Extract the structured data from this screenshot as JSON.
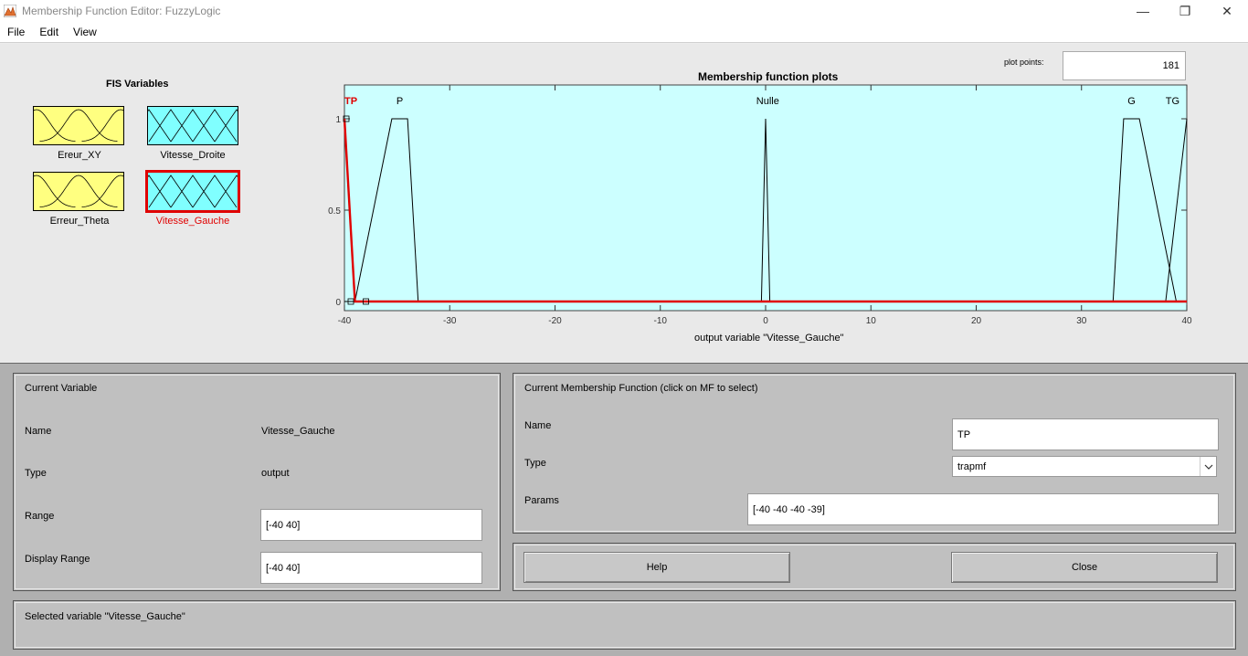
{
  "window": {
    "title": "Membership Function Editor: FuzzyLogic",
    "minimize_glyph": "—",
    "restore_glyph": "❐",
    "close_glyph": "✕"
  },
  "menu": [
    "File",
    "Edit",
    "View"
  ],
  "fis": {
    "title": "FIS Variables",
    "variables": [
      {
        "name": "Ereur_XY",
        "kind": "input",
        "color": "#ffff80"
      },
      {
        "name": "Vitesse_Droite",
        "kind": "output",
        "color": "#80ffff"
      },
      {
        "name": "Erreur_Theta",
        "kind": "input",
        "color": "#ffff80"
      },
      {
        "name": "Vitesse_Gauche",
        "kind": "output",
        "color": "#80ffff",
        "selected": true
      }
    ]
  },
  "plot_points": {
    "label": "plot points:",
    "value": "181"
  },
  "chart_data": {
    "type": "line",
    "title": "Membership function plots",
    "xlabel": "output variable \"Vitesse_Gauche\"",
    "xlim": [
      -40,
      40
    ],
    "ylim": [
      0,
      1
    ],
    "xticks": [
      -40,
      -30,
      -20,
      -10,
      0,
      10,
      20,
      30,
      40
    ],
    "yticks": [
      0,
      0.5,
      1
    ],
    "background": "#ccffff",
    "selected_color": "#e00000",
    "series": [
      {
        "name": "TP",
        "type": "trapmf",
        "params": [
          -40,
          -40,
          -40,
          -39
        ],
        "selected": true
      },
      {
        "name": "P",
        "type": "trapmf",
        "params": [
          -39,
          -35.5,
          -34,
          -33
        ]
      },
      {
        "name": "Nulle",
        "type": "trimf",
        "params": [
          -0.4,
          0,
          0.4
        ]
      },
      {
        "name": "G",
        "type": "trapmf",
        "params": [
          33,
          34,
          35.5,
          39
        ]
      },
      {
        "name": "TG",
        "type": "trapmf",
        "params": [
          38,
          40,
          40,
          40
        ]
      }
    ]
  },
  "current_variable": {
    "title": "Current Variable",
    "name_label": "Name",
    "name_value": "Vitesse_Gauche",
    "type_label": "Type",
    "type_value": "output",
    "range_label": "Range",
    "range_value": "[-40 40]",
    "display_range_label": "Display Range",
    "display_range_value": "[-40 40]"
  },
  "current_mf": {
    "title": "Current Membership Function (click on MF to select)",
    "name_label": "Name",
    "name_value": "TP",
    "type_label": "Type",
    "type_value": "trapmf",
    "params_label": "Params",
    "params_value": "[-40 -40 -40 -39]"
  },
  "buttons": {
    "help": "Help",
    "close": "Close"
  },
  "status": "Selected variable \"Vitesse_Gauche\""
}
